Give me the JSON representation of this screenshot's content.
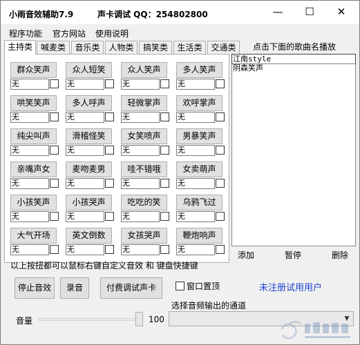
{
  "title": {
    "app": "小雨音效辅助7.9",
    "contact": "声卡调试 QQ：254802800"
  },
  "window_controls": {
    "minimize": "—",
    "maximize": "☐",
    "close": "✕"
  },
  "menu": [
    "程序功能",
    "官方网站",
    "使用说明"
  ],
  "tabs": [
    "主持类",
    "喊麦类",
    "音乐类",
    "人物类",
    "搞笑类",
    "生活类",
    "交通类"
  ],
  "right_hint": "点击下面的歌曲名播放",
  "sound_rows": [
    [
      "群众笑声",
      "众人短笑",
      "众人笑声",
      "多人笑声"
    ],
    [
      "哄笑笑声",
      "多人呼声",
      "轻微掌声",
      "欢呼掌声"
    ],
    [
      "纯尖叫声",
      "滑稽怪笑",
      "女笑喷声",
      "男暴笑声"
    ],
    [
      "亲嘴声女",
      "麦吻麦男",
      "哇不错哦",
      "女卖萌声"
    ],
    [
      "小孩笑声",
      "小孩哭声",
      "吃吃的笑",
      "乌鸦飞过"
    ],
    [
      "大气开场",
      "英文倒数",
      "女孩哭声",
      "鞭炮响声"
    ]
  ],
  "hotkey_value": "无",
  "songs": [
    "江南style",
    "阴森笑声"
  ],
  "song_buttons": {
    "add": "添加",
    "pause": "暂停",
    "delete": "删除"
  },
  "note": "以上按扭都可以鼠标右键自定义音效 和 键盘快捷键",
  "buttons": {
    "stop": "停止音效",
    "record": "录音",
    "paid": "付费调试声卡"
  },
  "topmost_label": "窗口置顶",
  "status": "未注册试用用户",
  "channel_label": "选择音频输出的通道",
  "volume": {
    "label": "音量",
    "value": "100",
    "level": 1.0
  },
  "colors": {
    "status": "#1e40d8",
    "window_bg": "#f0f0f0"
  },
  "icons": {
    "combo_arrow": "chevron-down-icon",
    "watermark": "watermark-logo"
  }
}
